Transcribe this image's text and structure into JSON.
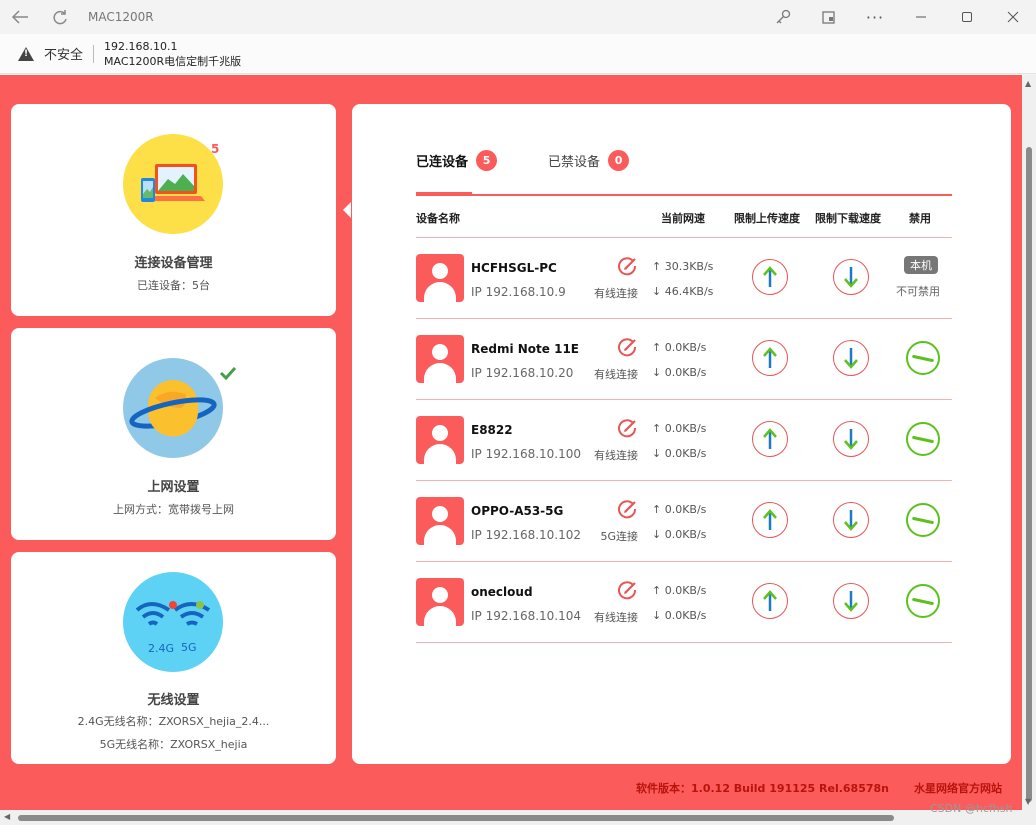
{
  "window": {
    "title": "MAC1200R"
  },
  "addressbar": {
    "security_label": "不安全",
    "url": "192.168.10.1",
    "page_title": "MAC1200R电信定制千兆版"
  },
  "cards": [
    {
      "title": "连接设备管理",
      "sub": "已连设备：5台",
      "badge": "5"
    },
    {
      "title": "上网设置",
      "sub": "上网方式：宽带拨号上网"
    },
    {
      "title": "无线设置",
      "sub": "2.4G无线名称：ZXORSX_hejia_2.4...",
      "sub2": "5G无线名称：ZXORSX_hejia",
      "label24": "2.4G",
      "label5": "5G"
    }
  ],
  "tabs": {
    "connected": {
      "label": "已连设备",
      "count": "5"
    },
    "blocked": {
      "label": "已禁设备",
      "count": "0"
    }
  },
  "table": {
    "headers": {
      "name": "设备名称",
      "speed": "当前网速",
      "limit_up": "限制上传速度",
      "limit_down": "限制下载速度",
      "ban": "禁用"
    },
    "rows": [
      {
        "name": "HCFHSGL-PC",
        "ip": "IP 192.168.10.9",
        "conn": "有线连接",
        "up": "↑ 30.3KB/s",
        "down": "↓ 46.4KB/s",
        "local": "本机",
        "local_note": "不可禁用"
      },
      {
        "name": "Redmi Note 11E",
        "ip": "IP 192.168.10.20",
        "conn": "有线连接",
        "up": "↑ 0.0KB/s",
        "down": "↓ 0.0KB/s"
      },
      {
        "name": "E8822",
        "ip": "IP 192.168.10.100",
        "conn": "有线连接",
        "up": "↑ 0.0KB/s",
        "down": "↓ 0.0KB/s"
      },
      {
        "name": "OPPO-A53-5G",
        "ip": "IP 192.168.10.102",
        "conn": "5G连接",
        "up": "↑ 0.0KB/s",
        "down": "↓ 0.0KB/s"
      },
      {
        "name": "onecloud",
        "ip": "IP 192.168.10.104",
        "conn": "有线连接",
        "up": "↑ 0.0KB/s",
        "down": "↓ 0.0KB/s"
      }
    ]
  },
  "footer": {
    "version": "软件版本：1.0.12 Build 191125 Rel.68578n",
    "link": "水星网络官方网站",
    "watermark": "CSDN @hcfhsh"
  },
  "colors": {
    "brand": "#fc5b5b",
    "ok": "#5cc11d",
    "arrow_blue": "#1b7bc9",
    "arrow_green": "#5cc11d"
  }
}
